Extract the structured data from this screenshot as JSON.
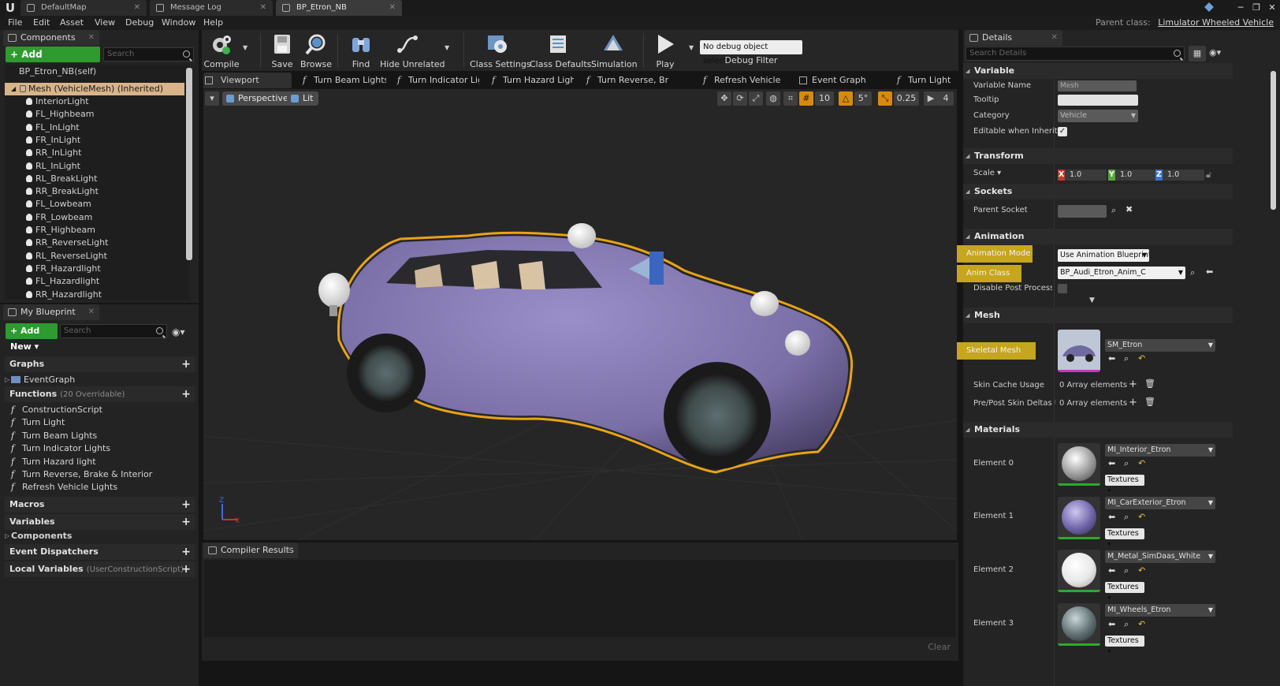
{
  "window": {
    "tabs": [
      {
        "label": "DefaultMap"
      },
      {
        "label": "Message Log"
      },
      {
        "label": "BP_Etron_NB"
      }
    ]
  },
  "menu": {
    "items": [
      "File",
      "Edit",
      "Asset",
      "View",
      "Debug",
      "Window",
      "Help"
    ],
    "parent_class_label": "Parent class:",
    "parent_class_value": "Limulator Wheeled Vehicle"
  },
  "components": {
    "tab_label": "Components",
    "add_button": "+ Add Component ▾",
    "search_placeholder": "Search",
    "self_label": "BP_Etron_NB(self)",
    "mesh_label": "Mesh (VehicleMesh) (Inherited)",
    "children": [
      "InteriorLight",
      "FL_Highbeam",
      "FL_InLight",
      "FR_InLight",
      "RR_InLight",
      "RL_InLight",
      "RL_BreakLight",
      "RR_BreakLight",
      "FL_Lowbeam",
      "FR_Lowbeam",
      "FR_Highbeam",
      "RR_ReverseLight",
      "RL_ReverseLight",
      "FR_Hazardlight",
      "FL_Hazardlight",
      "RR_Hazardlight"
    ]
  },
  "blueprint": {
    "tab_label": "My Blueprint",
    "add_new": "+ Add New ▾",
    "search_placeholder": "Search",
    "graphs_label": "Graphs",
    "event_graph": "EventGraph",
    "functions_label": "Functions",
    "functions_sub": "(20 Overridable)",
    "functions": [
      "ConstructionScript",
      "Turn Light",
      "Turn Beam Lights",
      "Turn Indicator Lights",
      "Turn Hazard light",
      "Turn Reverse, Brake & Interior",
      "Refresh Vehicle Lights"
    ],
    "macros_label": "Macros",
    "variables_label": "Variables",
    "components_label": "Components",
    "dispatchers_label": "Event Dispatchers",
    "local_vars_label": "Local Variables",
    "local_vars_sub": "(UserConstructionScript)"
  },
  "toolbar": {
    "compile": "Compile",
    "save": "Save",
    "browse": "Browse",
    "find": "Find",
    "hide_unrelated": "Hide Unrelated",
    "class_settings": "Class Settings",
    "class_defaults": "Class Defaults",
    "simulation": "Simulation",
    "play": "Play",
    "debug_select": "No debug object selected ▾",
    "debug_filter": "Debug Filter"
  },
  "editor_tabs": [
    "Viewport",
    "Turn Beam Lights",
    "Turn Indicator Lig",
    "Turn Hazard Ligh",
    "Turn Reverse, Bral",
    "Refresh Vehicle Li",
    "Event Graph",
    "Turn Light"
  ],
  "viewport": {
    "perspective": "Perspective",
    "lit": "Lit",
    "grid_snap": "10",
    "rot_snap": "5°",
    "scale_snap": "0.25",
    "camera_speed": "4",
    "axis_x": "X",
    "axis_z": "Z",
    "car_color": "#7b6fa8",
    "selection_color": "#e8a317"
  },
  "compiler": {
    "tab_label": "Compiler Results",
    "clear": "Clear"
  },
  "details": {
    "tab_label": "Details",
    "search_placeholder": "Search Details",
    "variable": {
      "header": "Variable",
      "name_label": "Variable Name",
      "name_value": "Mesh",
      "tooltip_label": "Tooltip",
      "category_label": "Category",
      "category_value": "Vehicle",
      "editable_label": "Editable when Inherited"
    },
    "transform": {
      "header": "Transform",
      "scale_label": "Scale ▾",
      "x": "1.0",
      "y": "1.0",
      "z": "1.0"
    },
    "sockets": {
      "header": "Sockets",
      "parent_socket_label": "Parent Socket"
    },
    "animation": {
      "header": "Animation",
      "mode_label": "Animation Mode",
      "mode_value": "Use Animation Blueprint",
      "class_label": "Anim Class",
      "class_value": "BP_Audi_Etron_Anim_C",
      "disable_pp_label": "Disable Post Process Blu"
    },
    "mesh": {
      "header": "Mesh",
      "skeletal_label": "Skeletal Mesh",
      "skeletal_value": "SM_Etron",
      "skin_cache_label": "Skin Cache Usage",
      "skin_cache_value": "0 Array elements",
      "preskin_label": "Pre/Post Skin Deltas Usa",
      "preskin_value": "0 Array elements"
    },
    "materials": {
      "header": "Materials",
      "textures_label": "Textures ▾",
      "elements": [
        {
          "label": "Element 0",
          "value": "MI_Interior_Etron"
        },
        {
          "label": "Element 1",
          "value": "MI_CarExterior_Etron"
        },
        {
          "label": "Element 2",
          "value": "M_Metal_SimDaas_White"
        },
        {
          "label": "Element 3",
          "value": "MI_Wheels_Etron"
        }
      ]
    }
  }
}
